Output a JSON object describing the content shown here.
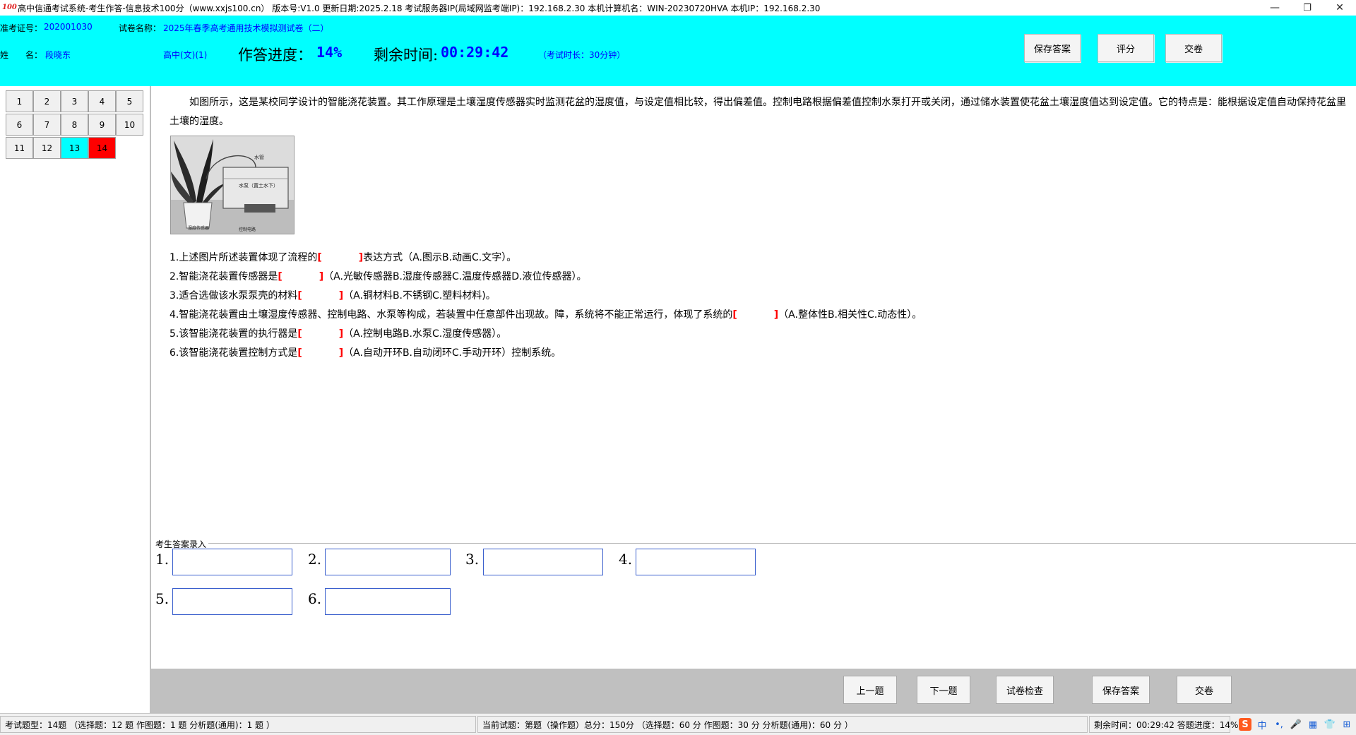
{
  "window": {
    "title": "高中信通考试系统-考生作答-信息技术100分（www.xxjs100.cn） 版本号:V1.0 更新日期:2025.2.18 考试服务器IP(局域网监考端IP)：192.168.2.30 本机计算机名：WIN-20230720HVA 本机IP：192.168.2.30",
    "logo_text": "100",
    "minimize": "—",
    "restore": "❐",
    "close": "✕"
  },
  "header": {
    "exam_id_label": "准考证号：",
    "exam_id": "202001030",
    "paper_name_label": "试卷名称：",
    "paper_name": "2025年春季高考通用技术模拟测试卷（二）",
    "name_label": "姓　　名：",
    "name": "段晓东",
    "level": "高中(文)(1)",
    "progress_label": "作答进度：",
    "progress": "14%",
    "remaining_label": "剩余时间:",
    "remaining": "00:29:42",
    "duration_note": "（考试时长：30分钟）",
    "save_button": "保存答案",
    "score_button": "评分",
    "submit_button": "交卷"
  },
  "question_nav": {
    "items": [
      {
        "num": "1",
        "state": "normal"
      },
      {
        "num": "2",
        "state": "normal"
      },
      {
        "num": "3",
        "state": "normal"
      },
      {
        "num": "4",
        "state": "normal"
      },
      {
        "num": "5",
        "state": "normal"
      },
      {
        "num": "6",
        "state": "normal"
      },
      {
        "num": "7",
        "state": "normal"
      },
      {
        "num": "8",
        "state": "normal"
      },
      {
        "num": "9",
        "state": "normal"
      },
      {
        "num": "10",
        "state": "normal"
      },
      {
        "num": "11",
        "state": "normal"
      },
      {
        "num": "12",
        "state": "normal"
      },
      {
        "num": "13",
        "state": "answered"
      },
      {
        "num": "14",
        "state": "current"
      }
    ],
    "colors": {
      "answered": "#00ffff",
      "current": "#ff0000"
    }
  },
  "question": {
    "intro": "如图所示，这是某校同学设计的智能浇花装置。其工作原理是土壤湿度传感器实时监测花盆的湿度值，与设定值相比较，得出偏差值。控制电路根据偏差值控制水泵打开或关闭，通过储水装置使花盆土壤湿度值达到设定值。它的特点是：能根据设定值自动保持花盆里土壤的湿度。",
    "figure_labels": {
      "water_pipe": "水管",
      "pump": "水泵（置土水下）",
      "sensor": "湿度传感器",
      "circuit": "控制电路"
    },
    "sub_questions": [
      {
        "before": "1.上述图片所述装置体现了流程的",
        "after": "表达方式（A.图示B.动画C.文字）。"
      },
      {
        "before": "2.智能浇花装置传感器是",
        "after": "（A.光敏传感器B.湿度传感器C.温度传感器D.液位传感器）。"
      },
      {
        "before": "3.适合选做该水泵泵壳的材料",
        "after": "（A.铜材料B.不锈钢C.塑料材料)。"
      },
      {
        "before": "4.智能浇花装置由土壤湿度传感器、控制电路、水泵等构成，若装置中任意部件出现故。障，系统将不能正常运行，体现了系统的",
        "after": "（A.整体性B.相关性C.动态性）。"
      },
      {
        "before": "5.该智能浇花装置的执行器是",
        "after": "（A.控制电路B.水泵C.湿度传感器）。"
      },
      {
        "before": "6.该智能浇花装置控制方式是",
        "after": "（A.自动开环B.自动闭环C.手动开环）控制系统。"
      }
    ],
    "blank_open": "[",
    "blank_close": "]"
  },
  "answer_entry": {
    "legend": "考生答案录入",
    "fields": [
      {
        "label": "1.",
        "value": ""
      },
      {
        "label": "2.",
        "value": ""
      },
      {
        "label": "3.",
        "value": ""
      },
      {
        "label": "4.",
        "value": ""
      },
      {
        "label": "5.",
        "value": ""
      },
      {
        "label": "6.",
        "value": ""
      }
    ]
  },
  "bottom_bar": {
    "prev": "上一题",
    "next": "下一题",
    "check": "试卷检查",
    "save": "保存答案",
    "submit": "交卷"
  },
  "status": {
    "types": "考试题型：14题 （选择题：12 题  作图题：1 题 分析题(通用)：1 题 ）",
    "current": "当前试题：第题（操作题）总分：150分 （选择题：60 分 作图题：30 分  分析题(通用)：60 分 ）",
    "remaining": "剩余时间：00:29:42 答题进度：14%",
    "tray": [
      "S",
      "中",
      "•,",
      "🎤",
      "▦",
      "👕",
      "⊞"
    ]
  }
}
